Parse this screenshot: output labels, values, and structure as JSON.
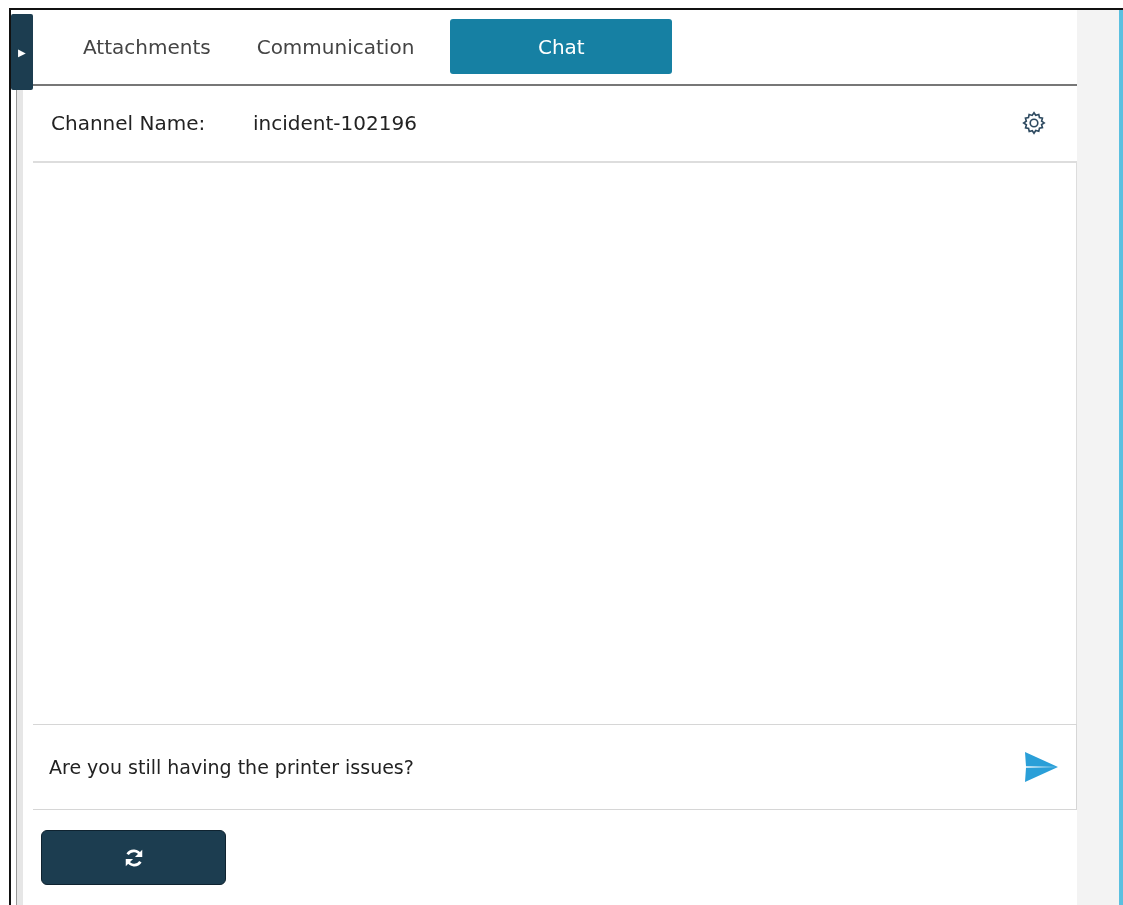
{
  "side_toggle": {
    "glyph": "▶"
  },
  "tabs": [
    {
      "label": "Attachments",
      "selected": false
    },
    {
      "label": "Communication",
      "selected": false
    },
    {
      "label": "Chat",
      "selected": true
    }
  ],
  "channel": {
    "label": "Channel Name:",
    "value": "incident-102196"
  },
  "message_input": {
    "value": "Are you still having the printer issues?"
  }
}
